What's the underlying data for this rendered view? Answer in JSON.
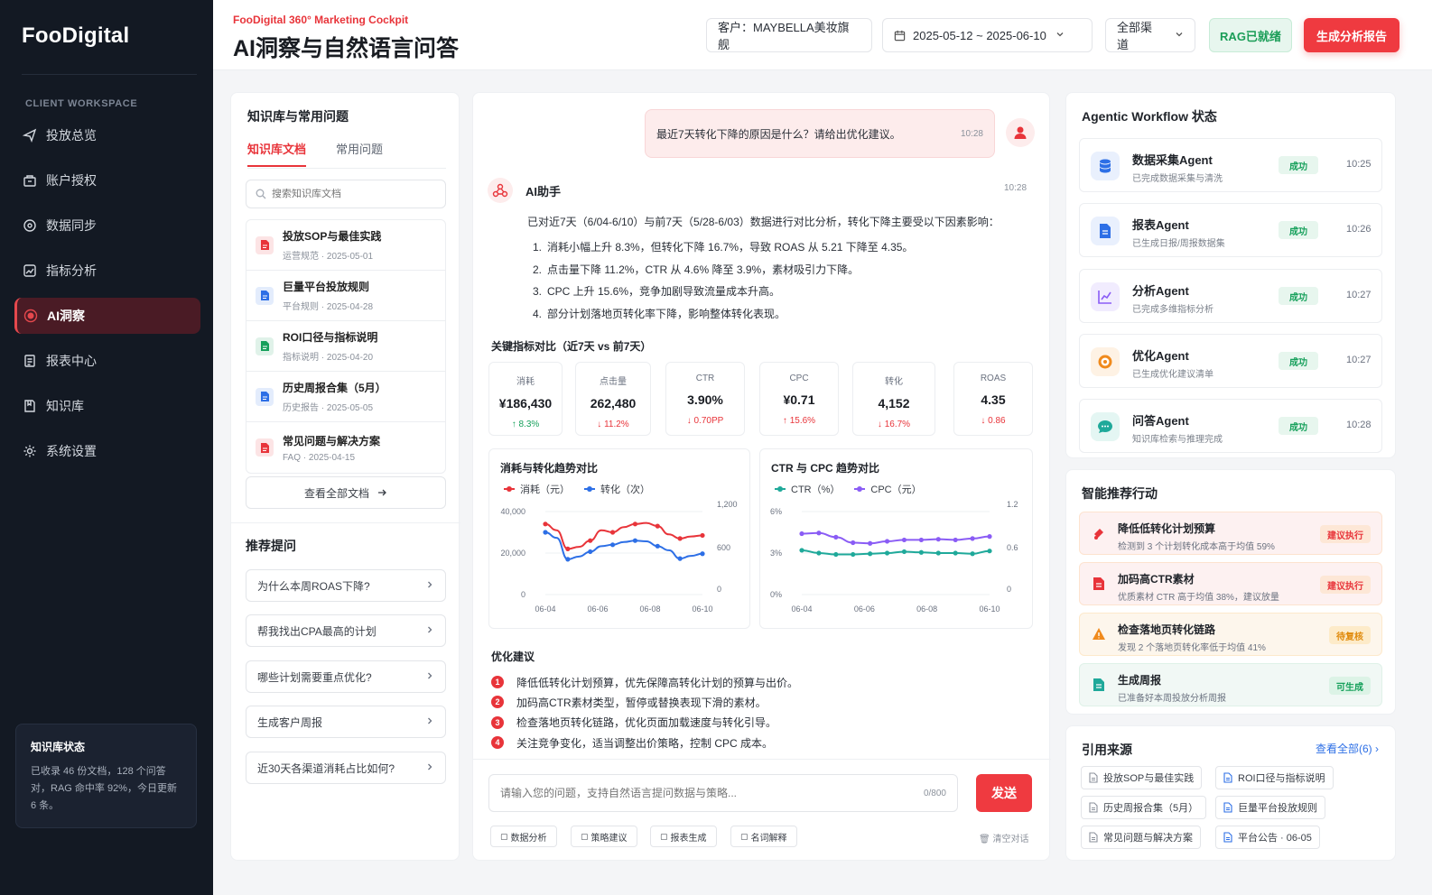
{
  "app": {
    "logo": "FooDigital"
  },
  "sidebar": {
    "section": "CLIENT WORKSPACE",
    "items": [
      {
        "label": "投放总览",
        "icon": "send-icon"
      },
      {
        "label": "账户授权",
        "icon": "account-icon"
      },
      {
        "label": "数据同步",
        "icon": "sync-icon"
      },
      {
        "label": "指标分析",
        "icon": "chart-icon"
      },
      {
        "label": "AI洞察",
        "icon": "record-icon",
        "active": true
      },
      {
        "label": "报表中心",
        "icon": "report-icon"
      },
      {
        "label": "知识库",
        "icon": "book-icon"
      },
      {
        "label": "系统设置",
        "icon": "gear-icon"
      }
    ],
    "kb_status": {
      "title": "知识库状态",
      "desc": "已收录 46 份文档，128 个问答对，RAG 命中率 92%，今日更新 6 条。"
    }
  },
  "header": {
    "subtitle": "FooDigital 360° Marketing Cockpit",
    "title": "AI洞察与自然语言问答",
    "client": "客户：MAYBELLA美妆旗舰",
    "date_range": "2025-05-12 ~ 2025-06-10",
    "channel": "全部渠道",
    "rag_status": "RAG已就绪",
    "generate_btn": "生成分析报告"
  },
  "kb": {
    "title": "知识库与常用问题",
    "tabs": [
      "知识库文档",
      "常用问题"
    ],
    "search_placeholder": "搜索知识库文档",
    "docs": [
      {
        "name": "投放SOP与最佳实践",
        "meta": "运营规范 · 2025-05-01",
        "color": "#e8343a"
      },
      {
        "name": "巨量平台投放规则",
        "meta": "平台规则 · 2025-04-28",
        "color": "#2d6fe6"
      },
      {
        "name": "ROI口径与指标说明",
        "meta": "指标说明 · 2025-04-20",
        "color": "#16a05b"
      },
      {
        "name": "历史周报合集（5月）",
        "meta": "历史报告 · 2025-05-05",
        "color": "#2d6fe6"
      },
      {
        "name": "常见问题与解决方案",
        "meta": "FAQ · 2025-04-15",
        "color": "#e8343a"
      }
    ],
    "view_all": "查看全部文档",
    "rec_title": "推荐提问",
    "questions": [
      "为什么本周ROAS下降?",
      "帮我找出CPA最高的计划",
      "哪些计划需要重点优化?",
      "生成客户周报",
      "近30天各渠道消耗占比如何?"
    ]
  },
  "chat": {
    "user_msg": "最近7天转化下降的原因是什么？请给出优化建议。",
    "user_time": "10:28",
    "ai_name": "AI助手",
    "ai_time": "10:28",
    "ai_intro": "已对近7天（6/04-6/10）与前7天（5/28-6/03）数据进行对比分析，转化下降主要受以下因素影响：",
    "ai_points": [
      "消耗小幅上升 8.3%，但转化下降 16.7%，导致 ROAS 从 5.21 下降至 4.35。",
      "点击量下降 11.2%，CTR 从 4.6% 降至 3.9%，素材吸引力下降。",
      "CPC 上升 15.6%，竞争加剧导致流量成本升高。",
      "部分计划落地页转化率下降，影响整体转化表现。"
    ],
    "metrics_title": "关键指标对比（近7天 vs 前7天）",
    "metrics": [
      {
        "label": "消耗",
        "value": "¥186,430",
        "change": "↑ 8.3%",
        "dir": "up"
      },
      {
        "label": "点击量",
        "value": "262,480",
        "change": "↓ 11.2%",
        "dir": "down"
      },
      {
        "label": "CTR",
        "value": "3.90%",
        "change": "↓ 0.70PP",
        "dir": "down"
      },
      {
        "label": "CPC",
        "value": "¥0.71",
        "change": "↑ 15.6%",
        "dir": "down"
      },
      {
        "label": "转化",
        "value": "4,152",
        "change": "↓ 16.7%",
        "dir": "down"
      },
      {
        "label": "ROAS",
        "value": "4.35",
        "change": "↓ 0.86",
        "dir": "down"
      }
    ],
    "opt_title": "优化建议",
    "opts": [
      "降低低转化计划预算，优先保障高转化计划的预算与出价。",
      "加码高CTR素材类型，暂停或替换表现下滑的素材。",
      "检查落地页转化链路，优化页面加载速度与转化引导。",
      "关注竞争变化，适当调整出价策略，控制 CPC 成本。"
    ],
    "input_placeholder": "请输入您的问题，支持自然语言提问数据与策略...",
    "char_count": "0/800",
    "send": "发送",
    "quick": [
      "数据分析",
      "策略建议",
      "报表生成",
      "名词解释"
    ],
    "clear": "清空对话"
  },
  "chart_data": [
    {
      "type": "line",
      "title": "消耗与转化趋势对比",
      "x": [
        "06-04",
        "06-05",
        "06-06",
        "06-07",
        "06-08",
        "06-09",
        "06-10"
      ],
      "xticks": [
        "06-04",
        "06-06",
        "06-08",
        "06-10"
      ],
      "series": [
        {
          "name": "消耗（元）",
          "axis": "left",
          "color": "#e8343a",
          "values": [
            34000,
            31000,
            22000,
            23000,
            26000,
            31000,
            30000,
            32500,
            34000,
            34500,
            33000,
            29000,
            27000,
            28000,
            28500
          ]
        },
        {
          "name": "转化（次）",
          "axis": "right",
          "color": "#2d6fe6",
          "values": [
            900,
            820,
            510,
            550,
            620,
            700,
            720,
            760,
            780,
            770,
            700,
            640,
            520,
            560,
            590
          ]
        }
      ],
      "left_ticks": [
        "40,000",
        "20,000",
        "0"
      ],
      "right_ticks": [
        "1,200",
        "600",
        "0"
      ],
      "ylim_left": [
        0,
        40000
      ],
      "ylim_right": [
        0,
        1200
      ]
    },
    {
      "type": "line",
      "title": "CTR 与 CPC 趋势对比",
      "x": [
        "06-04",
        "06-05",
        "06-06",
        "06-07",
        "06-08",
        "06-09",
        "06-10"
      ],
      "xticks": [
        "06-04",
        "06-06",
        "06-08",
        "06-10"
      ],
      "series": [
        {
          "name": "CTR（%）",
          "axis": "left",
          "color": "#1fa99a",
          "values": [
            3.2,
            3.0,
            2.9,
            2.9,
            2.95,
            3.0,
            3.1,
            3.05,
            3.0,
            3.0,
            2.95,
            3.15
          ]
        },
        {
          "name": "CPC（元）",
          "axis": "right",
          "color": "#8a5cf5",
          "values": [
            0.88,
            0.89,
            0.83,
            0.75,
            0.74,
            0.77,
            0.79,
            0.79,
            0.8,
            0.79,
            0.81,
            0.84
          ]
        }
      ],
      "left_ticks": [
        "6%",
        "3%",
        "0%"
      ],
      "right_ticks": [
        "1.2",
        "0.6",
        "0"
      ],
      "ylim_left": [
        0,
        6
      ],
      "ylim_right": [
        0,
        1.2
      ]
    }
  ],
  "workflow": {
    "title": "Agentic Workflow 状态",
    "agents": [
      {
        "name": "数据采集Agent",
        "desc": "已完成数据采集与清洗",
        "status": "成功",
        "time": "10:25",
        "icon": "database-icon",
        "color": "#2d6fe6",
        "bg": "#e9f0fd"
      },
      {
        "name": "报表Agent",
        "desc": "已生成日报/周报数据集",
        "status": "成功",
        "time": "10:26",
        "icon": "document-icon",
        "color": "#2d6fe6",
        "bg": "#e9f0fd"
      },
      {
        "name": "分析Agent",
        "desc": "已完成多维指标分析",
        "status": "成功",
        "time": "10:27",
        "icon": "analytics-icon",
        "color": "#8a5cf5",
        "bg": "#f1ecfe"
      },
      {
        "name": "优化Agent",
        "desc": "已生成优化建议清单",
        "status": "成功",
        "time": "10:27",
        "icon": "target-icon",
        "color": "#f08a1c",
        "bg": "#fef2e4"
      },
      {
        "name": "问答Agent",
        "desc": "知识库检索与推理完成",
        "status": "成功",
        "time": "10:28",
        "icon": "chat-icon",
        "color": "#1fa99a",
        "bg": "#e4f6f3"
      }
    ]
  },
  "actions": {
    "title": "智能推荐行动",
    "items": [
      {
        "name": "降低低转化计划预算",
        "desc": "检测到 3 个计划转化成本高于均值 59%",
        "badge": "建议执行",
        "icon": "budget-icon",
        "tone": "red"
      },
      {
        "name": "加码高CTR素材",
        "desc": "优质素材 CTR 高于均值 38%，建议放量",
        "badge": "建议执行",
        "icon": "material-icon",
        "tone": "red"
      },
      {
        "name": "检查落地页转化链路",
        "desc": "发现 2 个落地页转化率低于均值 41%",
        "badge": "待复核",
        "icon": "warning-icon",
        "tone": "orange"
      },
      {
        "name": "生成周报",
        "desc": "已准备好本周投放分析周报",
        "badge": "可生成",
        "icon": "report-icon",
        "tone": "green"
      }
    ]
  },
  "sources": {
    "title": "引用来源",
    "more": "查看全部(6) ›",
    "tags": [
      "投放SOP与最佳实践",
      "ROI口径与指标说明",
      "历史周报合集（5月）",
      "巨量平台投放规则",
      "常见问题与解决方案",
      "平台公告 · 06-05"
    ]
  }
}
